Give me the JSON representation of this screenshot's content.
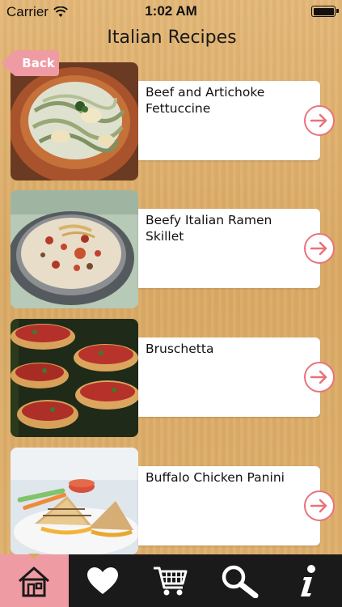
{
  "status_bar": {
    "carrier": "Carrier",
    "time": "1:02 AM"
  },
  "nav": {
    "back_label": "Back",
    "title": "Italian Recipes"
  },
  "recipes": [
    {
      "name": "Beef and Artichoke Fettuccine"
    },
    {
      "name": "Beefy Italian Ramen Skillet"
    },
    {
      "name": "Bruschetta"
    },
    {
      "name": "Buffalo Chicken Panini"
    }
  ],
  "tab_bar": {
    "items": [
      {
        "icon": "home-icon",
        "active": true
      },
      {
        "icon": "heart-icon",
        "active": false
      },
      {
        "icon": "cart-icon",
        "active": false
      },
      {
        "icon": "search-icon",
        "active": false
      },
      {
        "icon": "info-icon",
        "active": false
      }
    ]
  },
  "colors": {
    "accent_pink": "#ef9ba3",
    "arrow_red": "#e8737b",
    "tab_bar_bg": "#1a1a1a"
  }
}
